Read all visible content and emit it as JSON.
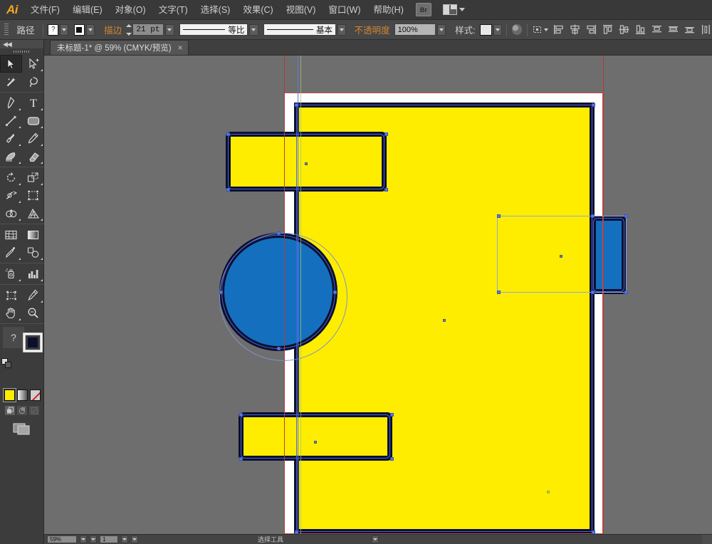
{
  "app": {
    "name": "Adobe Illustrator",
    "logo_text": "Ai"
  },
  "menubar": {
    "items": [
      {
        "label": "文件(F)",
        "name": "menu-file"
      },
      {
        "label": "编辑(E)",
        "name": "menu-edit"
      },
      {
        "label": "对象(O)",
        "name": "menu-object"
      },
      {
        "label": "文字(T)",
        "name": "menu-type"
      },
      {
        "label": "选择(S)",
        "name": "menu-select"
      },
      {
        "label": "效果(C)",
        "name": "menu-effect"
      },
      {
        "label": "视图(V)",
        "name": "menu-view"
      },
      {
        "label": "窗口(W)",
        "name": "menu-window"
      },
      {
        "label": "帮助(H)",
        "name": "menu-help"
      }
    ],
    "bridge_label": "Br",
    "arrange_label": ""
  },
  "controlbar": {
    "selection_label": "路径",
    "fill_swatch_value": "?",
    "stroke_label": "描边",
    "stroke_weight": "21 pt",
    "stroke_profile": "等比",
    "brush_definition": "基本",
    "opacity_label": "不透明度",
    "opacity_value": "100%",
    "style_label": "样式:",
    "icons": [
      "recolor-artwork-icon",
      "transform-icon",
      "align-left-icon",
      "align-center-horizontal-icon",
      "align-right-icon",
      "align-top-icon",
      "align-middle-vertical-icon",
      "align-bottom-icon",
      "distribute-top-icon",
      "distribute-center-icon",
      "distribute-bottom-icon",
      "distribute-spacing-icon"
    ]
  },
  "tabbar": {
    "document_title": "未标题-1* @ 59% (CMYK/预览)",
    "close_glyph": "×"
  },
  "toolbar": {
    "collapse_glyph": "◀◀",
    "tools": [
      {
        "name": "selection-tool",
        "glyph": "selection",
        "active": true,
        "corner": false
      },
      {
        "name": "direct-selection-tool",
        "glyph": "direct-selection",
        "active": false,
        "corner": true
      },
      {
        "name": "magic-wand-tool",
        "glyph": "magic-wand",
        "active": false,
        "corner": false
      },
      {
        "name": "lasso-tool",
        "glyph": "lasso",
        "active": false,
        "corner": false
      },
      {
        "name": "pen-tool",
        "glyph": "pen",
        "active": false,
        "corner": true
      },
      {
        "name": "type-tool",
        "glyph": "type",
        "active": false,
        "corner": true
      },
      {
        "name": "line-segment-tool",
        "glyph": "line",
        "active": false,
        "corner": true
      },
      {
        "name": "rectangle-tool",
        "glyph": "rectangle",
        "active": false,
        "corner": true
      },
      {
        "name": "paintbrush-tool",
        "glyph": "paintbrush",
        "active": false,
        "corner": true
      },
      {
        "name": "pencil-tool",
        "glyph": "pencil",
        "active": false,
        "corner": true
      },
      {
        "name": "blob-brush-tool",
        "glyph": "blob-brush",
        "active": false,
        "corner": true
      },
      {
        "name": "eraser-tool",
        "glyph": "eraser",
        "active": false,
        "corner": true
      },
      {
        "name": "rotate-tool",
        "glyph": "rotate",
        "active": false,
        "corner": true
      },
      {
        "name": "scale-tool",
        "glyph": "scale",
        "active": false,
        "corner": true
      },
      {
        "name": "width-tool",
        "glyph": "width",
        "active": false,
        "corner": true
      },
      {
        "name": "free-transform-tool",
        "glyph": "free-transform",
        "active": false,
        "corner": false
      },
      {
        "name": "shape-builder-tool",
        "glyph": "shape-builder",
        "active": false,
        "corner": true
      },
      {
        "name": "perspective-grid-tool",
        "glyph": "perspective-grid",
        "active": false,
        "corner": true
      },
      {
        "name": "mesh-tool",
        "glyph": "mesh",
        "active": false,
        "corner": false
      },
      {
        "name": "gradient-tool",
        "glyph": "gradient",
        "active": false,
        "corner": false
      },
      {
        "name": "eyedropper-tool",
        "glyph": "eyedropper",
        "active": false,
        "corner": true
      },
      {
        "name": "blend-tool",
        "glyph": "blend",
        "active": false,
        "corner": true
      },
      {
        "name": "symbol-sprayer-tool",
        "glyph": "symbol-sprayer",
        "active": false,
        "corner": true
      },
      {
        "name": "column-graph-tool",
        "glyph": "column-graph",
        "active": false,
        "corner": true
      },
      {
        "name": "artboard-tool",
        "glyph": "artboard",
        "active": false,
        "corner": false
      },
      {
        "name": "slice-tool",
        "glyph": "slice",
        "active": false,
        "corner": true
      },
      {
        "name": "hand-tool",
        "glyph": "hand",
        "active": false,
        "corner": true
      },
      {
        "name": "zoom-tool",
        "glyph": "zoom",
        "active": false,
        "corner": false
      }
    ],
    "help_glyph": "?",
    "colors": {
      "fill_color": "#ffed00",
      "stroke_color": "#0b0f2e",
      "gradient_label": "",
      "none_label": ""
    },
    "draw_modes": [
      "draw-normal",
      "draw-behind",
      "draw-inside"
    ]
  },
  "canvas": {
    "zoom_level": "59%",
    "color_mode": "CMYK",
    "view_mode": "预览",
    "artboard_bg": "#ffffff",
    "canvas_bg": "#6e6e6e",
    "artboard_guide_color": "#c24b4b"
  },
  "artwork": {
    "fill_yellow": "#ffed00",
    "fill_blue": "#1470be",
    "stroke_navy": "#0b0f2e",
    "selection_blue": "#4a63d8",
    "shapes": [
      {
        "name": "main-rectangle",
        "fill": "#ffed00",
        "stroke": "#0b0f2e",
        "selected": true
      },
      {
        "name": "top-left-rounded-rectangle",
        "fill": "#ffed00",
        "stroke": "#0b0f2e",
        "selected": true
      },
      {
        "name": "bottom-left-rounded-rectangle",
        "fill": "#ffed00",
        "stroke": "#0b0f2e",
        "selected": true
      },
      {
        "name": "left-blue-circle",
        "fill": "#1470be",
        "stroke": "#0b0f2e",
        "selected": true
      },
      {
        "name": "right-blue-rounded-rectangle",
        "fill": "#1470be",
        "stroke": "#0b0f2e",
        "selected": true
      }
    ]
  },
  "statusbar": {
    "zoom_value": "59%",
    "artboard_value": "1",
    "tool_text": "选择工具",
    "nav_first": "◀◀",
    "nav_prev": "◀",
    "nav_next": "▶",
    "nav_last": "▶▶"
  }
}
